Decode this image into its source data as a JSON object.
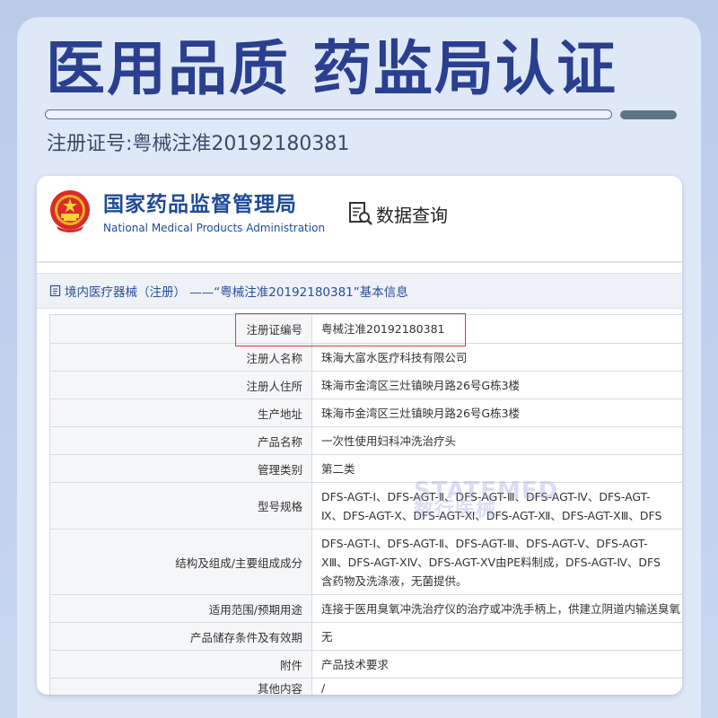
{
  "headline": "医用品质 药监局认证",
  "registration_line": "注册证号:粤械注准20192180381",
  "agency": {
    "name_cn": "国家药品监督管理局",
    "name_en": "National Medical Products Administration"
  },
  "query_label": "数据查询",
  "breadcrumb": "境内医疗器械（注册） ——“粤械注准20192180381”基本信息",
  "watermark": {
    "line1": "STATEMED",
    "line2": "数行医械"
  },
  "table": {
    "rows": [
      {
        "key": "注册证编号",
        "value": [
          "粤械注准20192180381"
        ]
      },
      {
        "key": "注册人名称",
        "value": [
          "珠海大富水医疗科技有限公司"
        ]
      },
      {
        "key": "注册人住所",
        "value": [
          "珠海市金湾区三灶镇映月路26号G栋3楼"
        ]
      },
      {
        "key": "生产地址",
        "value": [
          "珠海市金湾区三灶镇映月路26号G栋3楼"
        ]
      },
      {
        "key": "产品名称",
        "value": [
          "一次性使用妇科冲洗治疗头"
        ]
      },
      {
        "key": "管理类别",
        "value": [
          "第二类"
        ]
      },
      {
        "key": "型号规格",
        "value": [
          "DFS-AGT-Ⅰ、DFS-AGT-Ⅱ、DFS-AGT-Ⅲ、DFS-AGT-Ⅳ、DFS-AGT-",
          "Ⅸ、DFS-AGT-Ⅹ、DFS-AGT-Ⅺ、DFS-AGT-Ⅻ、DFS-AGT-ⅩⅢ、DFS"
        ]
      },
      {
        "key": "结构及组成/主要组成成分",
        "value": [
          "DFS-AGT-Ⅰ、DFS-AGT-Ⅱ、DFS-AGT-Ⅲ、DFS-AGT-Ⅴ、DFS-AGT-",
          "ⅩⅢ、DFS-AGT-ⅩⅣ、DFS-AGT-ⅩⅤ由PE料制成，DFS-AGT-Ⅳ、DFS",
          "含药物及洗涤液，无菌提供。"
        ]
      },
      {
        "key": "适用范围/预期用途",
        "value": [
          "连接于医用臭氧冲洗治疗仪的治疗或冲洗手柄上，供建立阴道内输送臭氧"
        ]
      },
      {
        "key": "产品储存条件及有效期",
        "value": [
          "无"
        ]
      },
      {
        "key": "附件",
        "value": [
          "产品技术要求"
        ]
      },
      {
        "key": "其他内容",
        "value": [
          "/"
        ]
      }
    ]
  },
  "colors": {
    "headline": "#2a3f8f",
    "agency": "#1f4a9a",
    "highlight": "#e03a3a"
  }
}
